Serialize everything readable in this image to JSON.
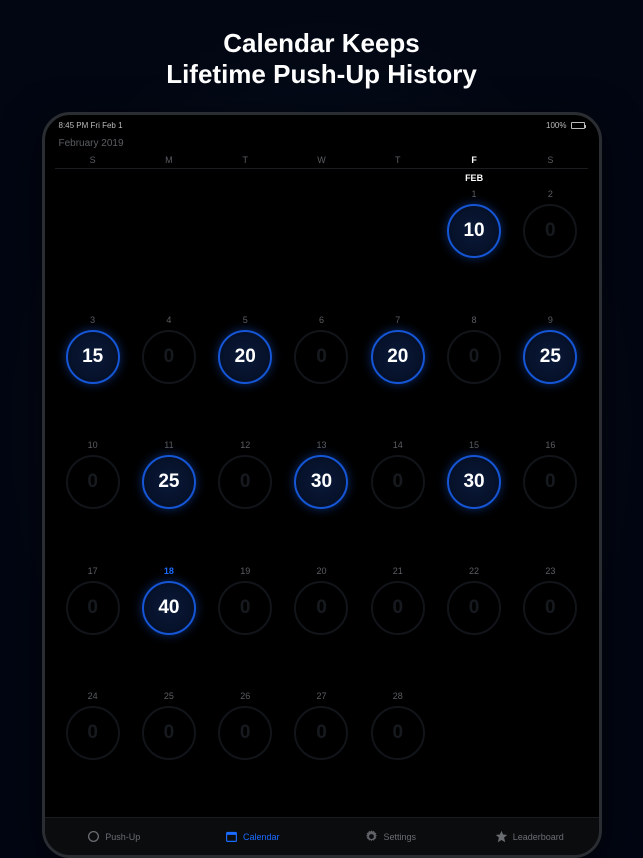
{
  "headline_line1": "Calendar Keeps",
  "headline_line2": "Lifetime Push-Up History",
  "status": {
    "left": "8:45 PM   Fri Feb 1",
    "battery_pct": "100%"
  },
  "month_label": "February 2019",
  "weekdays": [
    "S",
    "M",
    "T",
    "W",
    "T",
    "F",
    "S"
  ],
  "today_weekday_index": 5,
  "month_tag": "FEB",
  "days": [
    {
      "num": "",
      "val": null,
      "blank": true
    },
    {
      "num": "",
      "val": null,
      "blank": true
    },
    {
      "num": "",
      "val": null,
      "blank": true
    },
    {
      "num": "",
      "val": null,
      "blank": true
    },
    {
      "num": "",
      "val": null,
      "blank": true
    },
    {
      "num": "1",
      "val": 10,
      "active": true
    },
    {
      "num": "2",
      "val": 0,
      "active": false
    },
    {
      "num": "3",
      "val": 15,
      "active": true
    },
    {
      "num": "4",
      "val": 0,
      "active": false
    },
    {
      "num": "5",
      "val": 20,
      "active": true
    },
    {
      "num": "6",
      "val": 0,
      "active": false
    },
    {
      "num": "7",
      "val": 20,
      "active": true
    },
    {
      "num": "8",
      "val": 0,
      "active": false
    },
    {
      "num": "9",
      "val": 25,
      "active": true
    },
    {
      "num": "10",
      "val": 0,
      "active": false
    },
    {
      "num": "11",
      "val": 25,
      "active": true
    },
    {
      "num": "12",
      "val": 0,
      "active": false
    },
    {
      "num": "13",
      "val": 30,
      "active": true
    },
    {
      "num": "14",
      "val": 0,
      "active": false
    },
    {
      "num": "15",
      "val": 30,
      "active": true
    },
    {
      "num": "16",
      "val": 0,
      "active": false
    },
    {
      "num": "17",
      "val": 0,
      "active": false
    },
    {
      "num": "18",
      "val": 40,
      "active": true,
      "today": true
    },
    {
      "num": "19",
      "val": 0,
      "active": false
    },
    {
      "num": "20",
      "val": 0,
      "active": false
    },
    {
      "num": "21",
      "val": 0,
      "active": false
    },
    {
      "num": "22",
      "val": 0,
      "active": false
    },
    {
      "num": "23",
      "val": 0,
      "active": false
    },
    {
      "num": "24",
      "val": 0,
      "active": false
    },
    {
      "num": "25",
      "val": 0,
      "active": false
    },
    {
      "num": "26",
      "val": 0,
      "active": false
    },
    {
      "num": "27",
      "val": 0,
      "active": false
    },
    {
      "num": "28",
      "val": 0,
      "active": false
    }
  ],
  "tabs": [
    {
      "icon": "circle",
      "label": "Push-Up",
      "active": false
    },
    {
      "icon": "calendar",
      "label": "Calendar",
      "active": true
    },
    {
      "icon": "gear",
      "label": "Settings",
      "active": false
    },
    {
      "icon": "star",
      "label": "Leaderboard",
      "active": false
    }
  ]
}
